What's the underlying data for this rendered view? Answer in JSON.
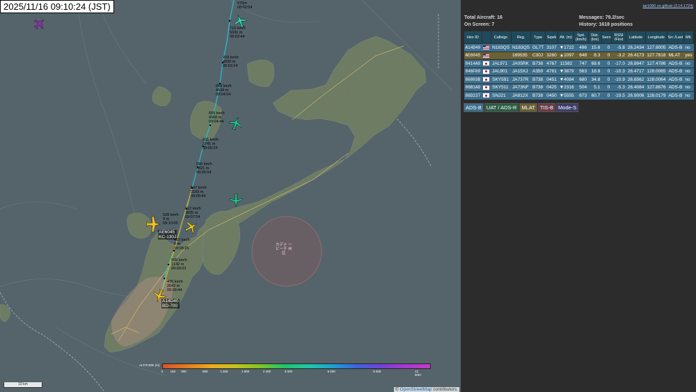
{
  "timestamp": "2025/11/16 09:10:24 (JST)",
  "github_link": "tar1090 on github (3.14.1724)",
  "stats": {
    "total_label": "Total Aircraft:",
    "total": "16",
    "onscreen_label": "On Screen:",
    "onscreen": "7",
    "messages_label": "Messages:",
    "messages": "79.2/sec",
    "history_label": "History:",
    "history": "1618 positions"
  },
  "table": {
    "headers": [
      "Hex ID",
      "",
      "Callsign",
      "Reg.",
      "Type",
      "Sqwk",
      "Alt. (m)",
      "Spd. (km/h)",
      "Dist. (km)",
      "Seen",
      "RSSI /First",
      "Latitude",
      "Longitude",
      "Src /Last",
      "Mlt."
    ],
    "rows": [
      {
        "hex": "A14D40",
        "flag": "us",
        "callsign": "N183QS",
        "reg": "N183QS",
        "type": "GL7T",
        "sqwk": "3107",
        "vs": "▼",
        "alt": "1722",
        "spd": "486",
        "dist": "15.6",
        "seen": "0",
        "rssi": "-5.8",
        "lat": "26.2434",
        "lon": "127.8005",
        "src": "ADS-B",
        "mlt": "no",
        "kind": "b"
      },
      {
        "hex": "AE6045",
        "flag": "us",
        "callsign": "",
        "reg": "169535",
        "type": "C30J",
        "sqwk": "3260",
        "vs": "▲",
        "alt": "1097",
        "spd": "648",
        "dist": "8.3",
        "seen": "0",
        "rssi": "-3.2",
        "lat": "26.4173",
        "lon": "127.7818",
        "src": "MLAT",
        "mlt": "yes",
        "kind": "m"
      },
      {
        "hex": "8414A9",
        "flag": "jp",
        "callsign": "JAL971",
        "reg": "JA05RK",
        "type": "B738",
        "sqwk": "4767",
        "vs": "",
        "alt": "11582",
        "spd": "747",
        "dist": "68.6",
        "seen": "0",
        "rssi": "-17.0",
        "lat": "26.8947",
        "lon": "127.4786",
        "src": "ADS-B",
        "mlt": "no",
        "kind": "b"
      },
      {
        "hex": "846F00",
        "flag": "jp",
        "callsign": "JAL901",
        "reg": "JA15XJ",
        "type": "A359",
        "sqwk": "4761",
        "vs": "▼",
        "alt": "3879",
        "spd": "563",
        "dist": "18.8",
        "seen": "0",
        "rssi": "-10.3",
        "lat": "26.4717",
        "lon": "128.0065",
        "src": "ADS-B",
        "mlt": "no",
        "kind": "b"
      },
      {
        "hex": "86803B",
        "flag": "jp",
        "callsign": "SKY591",
        "reg": "JA737R",
        "type": "B738",
        "sqwk": "0451",
        "vs": "▼",
        "alt": "4084",
        "spd": "680",
        "dist": "34.8",
        "seen": "0",
        "rssi": "-10.9",
        "lat": "26.6562",
        "lon": "128.0064",
        "src": "ADS-B",
        "mlt": "no",
        "kind": "b"
      },
      {
        "hex": "86B1AD",
        "flag": "jp",
        "callsign": "SKY511",
        "reg": "JA73NF",
        "type": "B738",
        "sqwk": "0425",
        "vs": "▼",
        "alt": "2316",
        "spd": "504",
        "dist": "5.1",
        "seen": "0",
        "rssi": "-5.3",
        "lat": "26.4084",
        "lon": "127.8876",
        "src": "ADS-B",
        "mlt": "no",
        "kind": "b"
      },
      {
        "hex": "86D237",
        "flag": "jp",
        "callsign": "SNJ21",
        "reg": "JA812X",
        "type": "B738",
        "sqwk": "0450",
        "vs": "▼",
        "alt": "5555",
        "spd": "673",
        "dist": "60.7",
        "seen": "0",
        "rssi": "-19.5",
        "lat": "26.9006",
        "lon": "128.0179",
        "src": "ADS-B",
        "mlt": "no",
        "kind": "b"
      }
    ]
  },
  "sources": [
    {
      "label": "ADS-B",
      "bg": "#3d6f8c",
      "fg": "#fff"
    },
    {
      "label": "UAT / ADS-R",
      "bg": "#2d5b43",
      "fg": "#fff"
    },
    {
      "label": "MLAT",
      "bg": "#6a6236",
      "fg": "#fff"
    },
    {
      "label": "TIS-B",
      "bg": "#6b3c47",
      "fg": "#fff"
    },
    {
      "label": "Mode-S",
      "bg": "#3c3c6b",
      "fg": "#fff"
    }
  ],
  "map": {
    "trail_labels": [
      "576m\n08:02:04",
      "716 km/h\n5331 m\n09:02:44",
      "703 km/h\n4930 m\n09:03:24",
      "689 km/h\n4534 m\n09:04:04",
      "655 km/h\n4368 m\n09:04:44",
      "631 km/h\n3741 m\n09:05:24",
      "590 km/h\n3421 m\n09:06:04",
      "547 km/h\n3109 m\n09:06:44",
      "512 km/h\n2835 m\n09:07:24",
      "528 km/h\n9 m\n09:10:05",
      "487 km/h\n0 m\n09:08:25",
      "505 km/h\n2142 m\n09:09:03",
      "476 km/h\n2042 m\n09:09:44"
    ],
    "aircraft_tags": [
      {
        "line1": "AE6045",
        "line2": "KC-130J"
      },
      {
        "line1": "A14D40",
        "line2": "BD-700"
      }
    ],
    "airport_label": "カデナ ー\nビーチ 州\n区",
    "altitude_title": "ALTITUDE (m)",
    "altitude_ticks": [
      "0",
      "150",
      "300",
      "600",
      "1 200",
      "1 800",
      "2 400",
      "3 000",
      "6 000",
      "9 000",
      "12 000+"
    ],
    "scale_label": "10 km",
    "attribution_prefix": "© ",
    "attribution_link": "OpenStreetMap",
    "attribution_suffix": " contributors."
  }
}
